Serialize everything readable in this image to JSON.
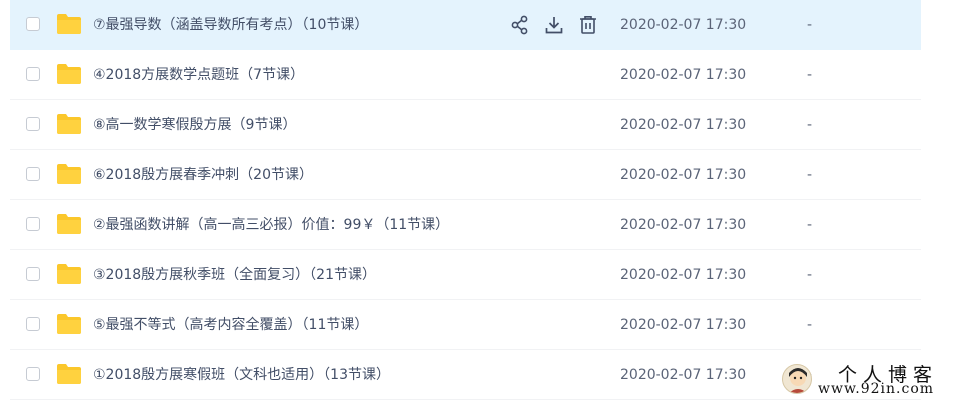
{
  "files": [
    {
      "name": "⑦最强导数（涵盖导数所有考点）（10节课）",
      "date": "2020-02-07 17:30",
      "size": "-",
      "hovered": true
    },
    {
      "name": "④2018方展数学点题班（7节课）",
      "date": "2020-02-07 17:30",
      "size": "-"
    },
    {
      "name": "⑧高一数学寒假殷方展（9节课）",
      "date": "2020-02-07 17:30",
      "size": "-"
    },
    {
      "name": "⑥2018殷方展春季冲刺（20节课）",
      "date": "2020-02-07 17:30",
      "size": "-"
    },
    {
      "name": "②最强函数讲解（高一高三必报）价值：99￥（11节课）",
      "date": "2020-02-07 17:30",
      "size": "-"
    },
    {
      "name": "③2018殷方展秋季班（全面复习）（21节课）",
      "date": "2020-02-07 17:30",
      "size": "-"
    },
    {
      "name": "⑤最强不等式（高考内容全覆盖）（11节课）",
      "date": "2020-02-07 17:30",
      "size": "-"
    },
    {
      "name": "①2018殷方展寒假班（文科也适用）（13节课）",
      "date": "2020-02-07 17:30",
      "size": "-"
    }
  ],
  "row_actions": [
    "share-icon",
    "download-icon",
    "delete-icon"
  ],
  "icons": {
    "folder": "folder-icon",
    "checkbox": "checkbox"
  },
  "colors": {
    "hover_bg": "#e4f3fd",
    "folder": "#fbc72b",
    "text": "#424e67"
  },
  "watermark": {
    "title": "个人博客",
    "url": "www.92in.com"
  }
}
